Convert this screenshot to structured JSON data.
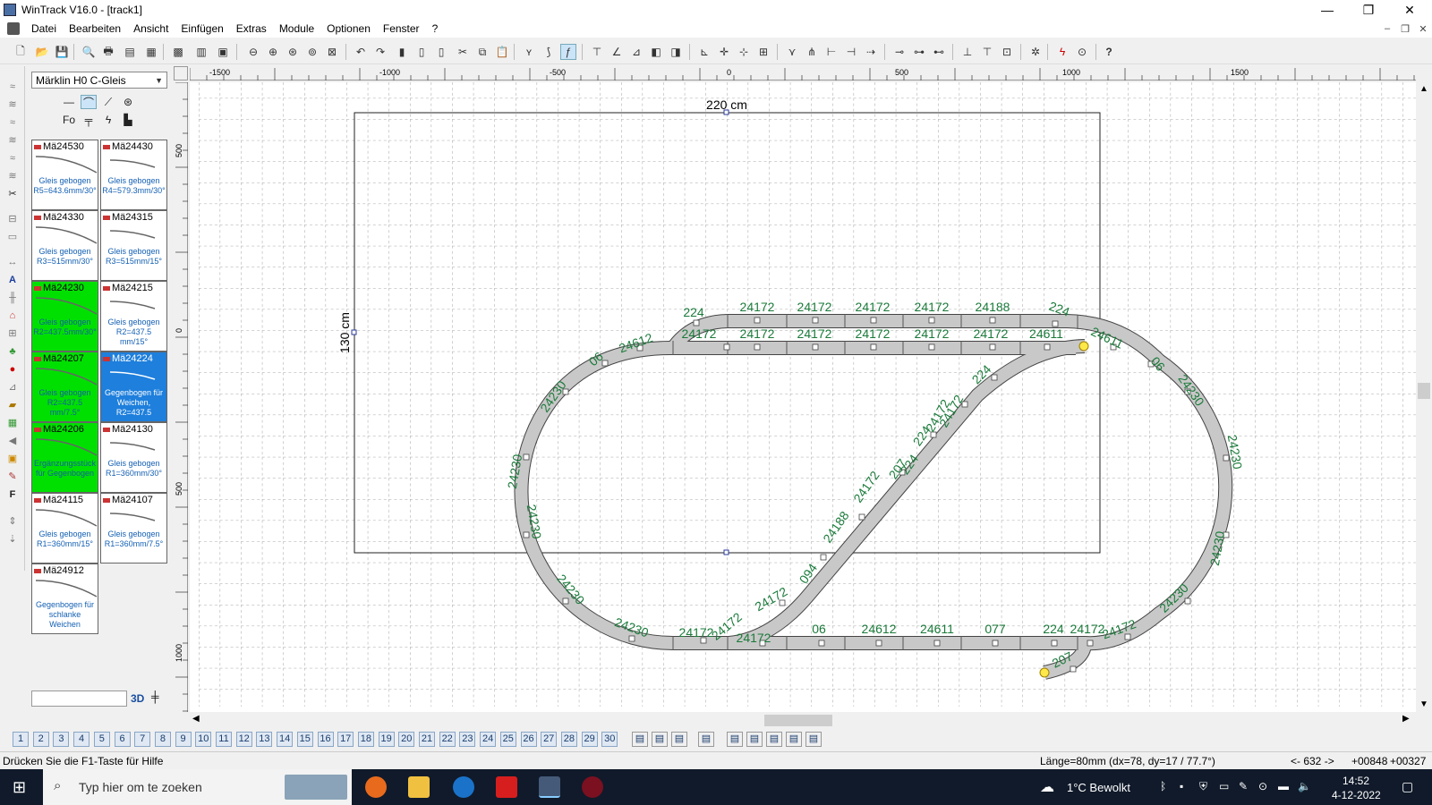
{
  "window": {
    "title": "WinTrack  V16.0 - [track1]",
    "minimize": "—",
    "maximize": "❐",
    "close": "✕"
  },
  "menu": [
    "Datei",
    "Bearbeiten",
    "Ansicht",
    "Einfügen",
    "Extras",
    "Module",
    "Optionen",
    "Fenster",
    "?"
  ],
  "library": {
    "selected": "Märklin H0 C-Gleis",
    "tiles": [
      {
        "code": "Mä24530",
        "desc": "Gleis gebogen R5=643.6mm/30°",
        "state": "normal"
      },
      {
        "code": "Mä24430",
        "desc": "Gleis gebogen R4=579.3mm/30°",
        "state": "normal"
      },
      {
        "code": "Mä24330",
        "desc": "Gleis gebogen R3=515mm/30°",
        "state": "normal"
      },
      {
        "code": "Mä24315",
        "desc": "Gleis gebogen R3=515mm/15°",
        "state": "normal"
      },
      {
        "code": "Mä24230",
        "desc": "Gleis gebogen R2=437.5mm/30°",
        "state": "green"
      },
      {
        "code": "Mä24215",
        "desc": "Gleis gebogen R2=437.5 mm/15°",
        "state": "normal"
      },
      {
        "code": "Mä24207",
        "desc": "Gleis gebogen R2=437.5 mm/7.5°",
        "state": "green"
      },
      {
        "code": "Mä24224",
        "desc": "Gegenbogen für Weichen, R2=437.5",
        "state": "blue"
      },
      {
        "code": "Mä24206",
        "desc": "Ergänzungsstück für Gegenbogen",
        "state": "green"
      },
      {
        "code": "Mä24130",
        "desc": "Gleis gebogen R1=360mm/30°",
        "state": "normal"
      },
      {
        "code": "Mä24115",
        "desc": "Gleis gebogen R1=360mm/15°",
        "state": "normal"
      },
      {
        "code": "Mä24107",
        "desc": "Gleis gebogen R1=360mm/7.5°",
        "state": "normal"
      },
      {
        "code": "Mä24912",
        "desc": "Gegenbogen für schlanke Weichen",
        "state": "normal"
      }
    ],
    "btn3d": "3D"
  },
  "rulers": {
    "h": [
      "-1500",
      "-1000",
      "-500",
      "0",
      "500",
      "1000",
      "1500"
    ],
    "v": [
      "500",
      "0",
      "500",
      "1000"
    ]
  },
  "board": {
    "width_label": "220 cm",
    "height_label": "130 cm"
  },
  "track_labels": [
    "224",
    "24172",
    "24172",
    "24172",
    "24172",
    "24188",
    "224",
    "24172",
    "24172",
    "24172",
    "24172",
    "24172",
    "24172",
    "24611",
    "24612",
    "06",
    "24611",
    "06",
    "24230",
    "24230",
    "24230",
    "24230",
    "24230",
    "24230",
    "24230",
    "24230",
    "24230",
    "224",
    "224",
    "24172",
    "24172",
    "24172",
    "24172",
    "24172",
    "24172",
    "06",
    "24612",
    "24611",
    "077",
    "224",
    "24172",
    "24172",
    "24172",
    "24188",
    "094",
    "207",
    "207",
    "224"
  ],
  "layers": [
    "1",
    "2",
    "3",
    "4",
    "5",
    "6",
    "7",
    "8",
    "9",
    "10",
    "11",
    "12",
    "13",
    "14",
    "15",
    "16",
    "17",
    "18",
    "19",
    "20",
    "21",
    "22",
    "23",
    "24",
    "25",
    "26",
    "27",
    "28",
    "29",
    "30"
  ],
  "status": {
    "hint": "Drücken Sie die  F1-Taste für Hilfe",
    "length": "Länge=80mm (dx=78, dy=17 / 77.7°)",
    "pos": "<- 632 ->",
    "x": "+00848",
    "y": "+00327"
  },
  "taskbar": {
    "search": "Typ hier om te zoeken",
    "weather": "1°C  Bewolkt",
    "time": "14:52",
    "date": "4-12-2022"
  },
  "colors": {
    "track": "#c8c8c8",
    "label": "#1a7a3a",
    "grid": "#808080",
    "selected_tile": "#1e7fdc",
    "used_tile": "#00e000"
  }
}
